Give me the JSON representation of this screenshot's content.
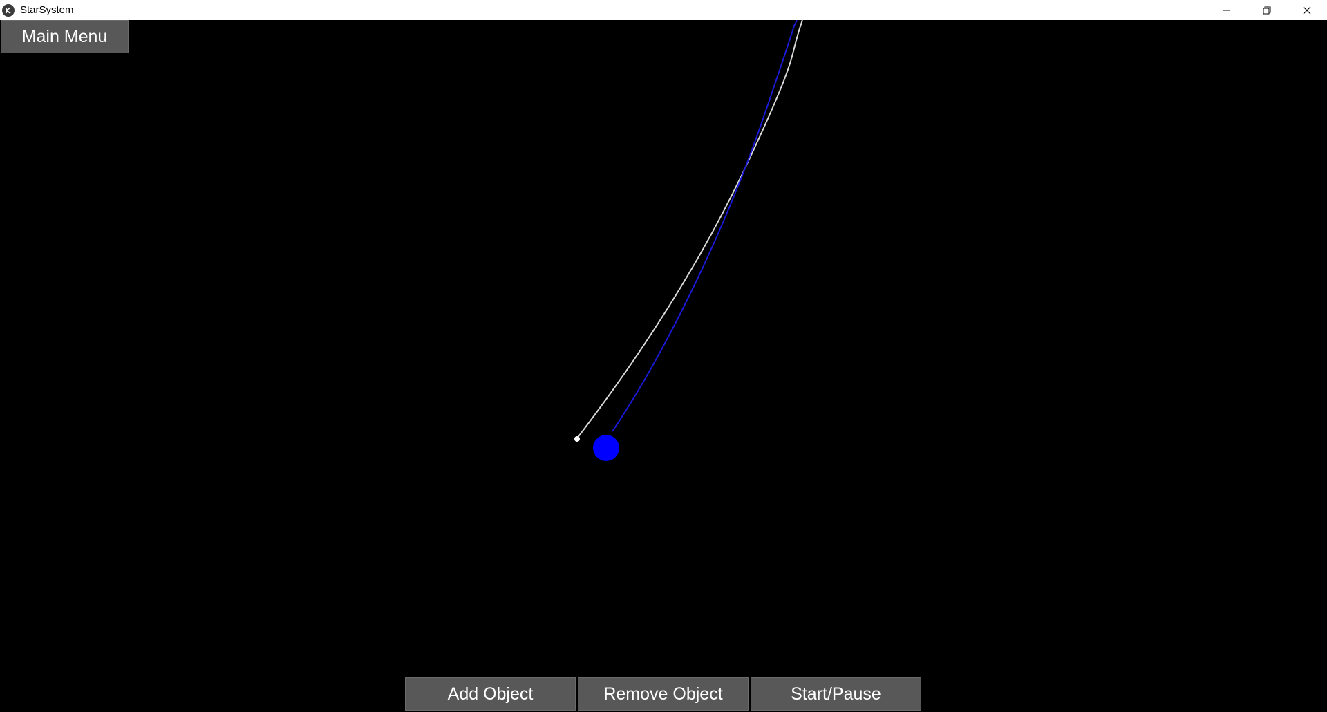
{
  "window": {
    "title": "StarSystem",
    "icon": "kivy-app-icon",
    "controls": [
      "minimize-icon",
      "restore-icon",
      "close-icon"
    ]
  },
  "toolbar": {
    "main_menu_label": "Main Menu"
  },
  "bottom_bar": {
    "add_label": "Add Object",
    "remove_label": "Remove Object",
    "start_pause_label": "Start/Pause"
  },
  "colors": {
    "background": "#000000",
    "button": "#585858",
    "planet": "#0000ff",
    "white_trail": "#d9d9d9",
    "blue_trail": "#1a1ad6"
  }
}
